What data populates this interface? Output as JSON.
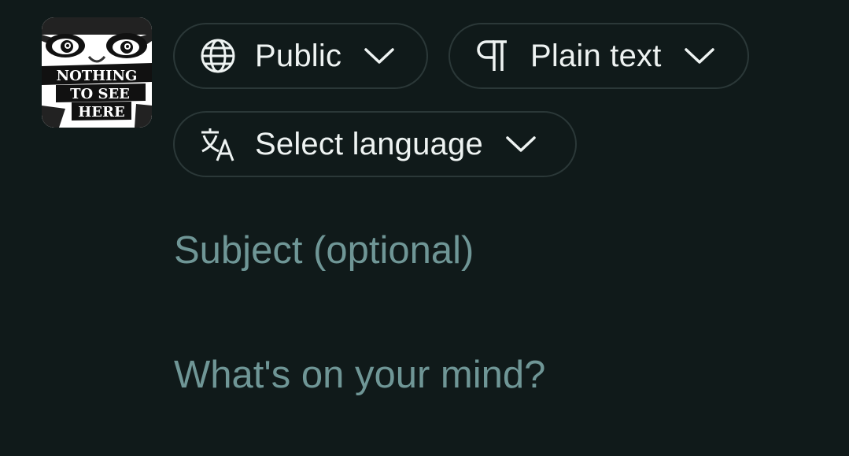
{
  "avatar": {
    "lines": [
      "NOTHING",
      "TO SEE",
      "HERE"
    ]
  },
  "toolbar": {
    "visibility_label": "Public",
    "visibility_icon": "globe-icon",
    "format_label": "Plain text",
    "format_icon": "pilcrow-icon",
    "language_label": "Select language",
    "language_icon": "translate-icon"
  },
  "compose": {
    "subject_placeholder": "Subject (optional)",
    "body_placeholder": "What's on your mind?"
  },
  "colors": {
    "background": "#101a1a",
    "pill_border": "#2b3838",
    "text": "#eef3f2",
    "placeholder": "#6f9696"
  }
}
